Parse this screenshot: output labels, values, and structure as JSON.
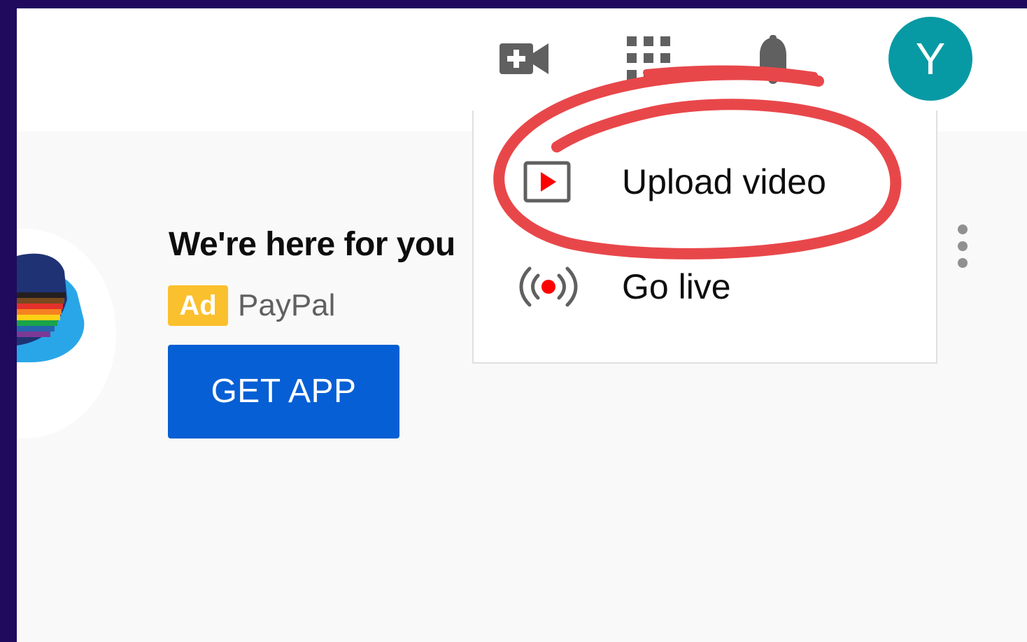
{
  "header": {
    "create_icon": "video-camera-plus-icon",
    "apps_icon": "apps-grid-icon",
    "notifications_icon": "bell-icon",
    "avatar_letter": "Y",
    "avatar_color": "#079aa4"
  },
  "ad": {
    "title": "We're here for you",
    "badge": "Ad",
    "advertiser": "PayPal",
    "cta_label": "GET APP",
    "cta_color": "#065fd4",
    "badge_color": "#fbc02d",
    "more_icon": "more-vert-icon"
  },
  "create_menu": {
    "items": [
      {
        "label": "Upload video",
        "icon": "upload-video-icon"
      },
      {
        "label": "Go live",
        "icon": "go-live-icon"
      }
    ]
  },
  "annotation": {
    "color": "#e8474a"
  }
}
